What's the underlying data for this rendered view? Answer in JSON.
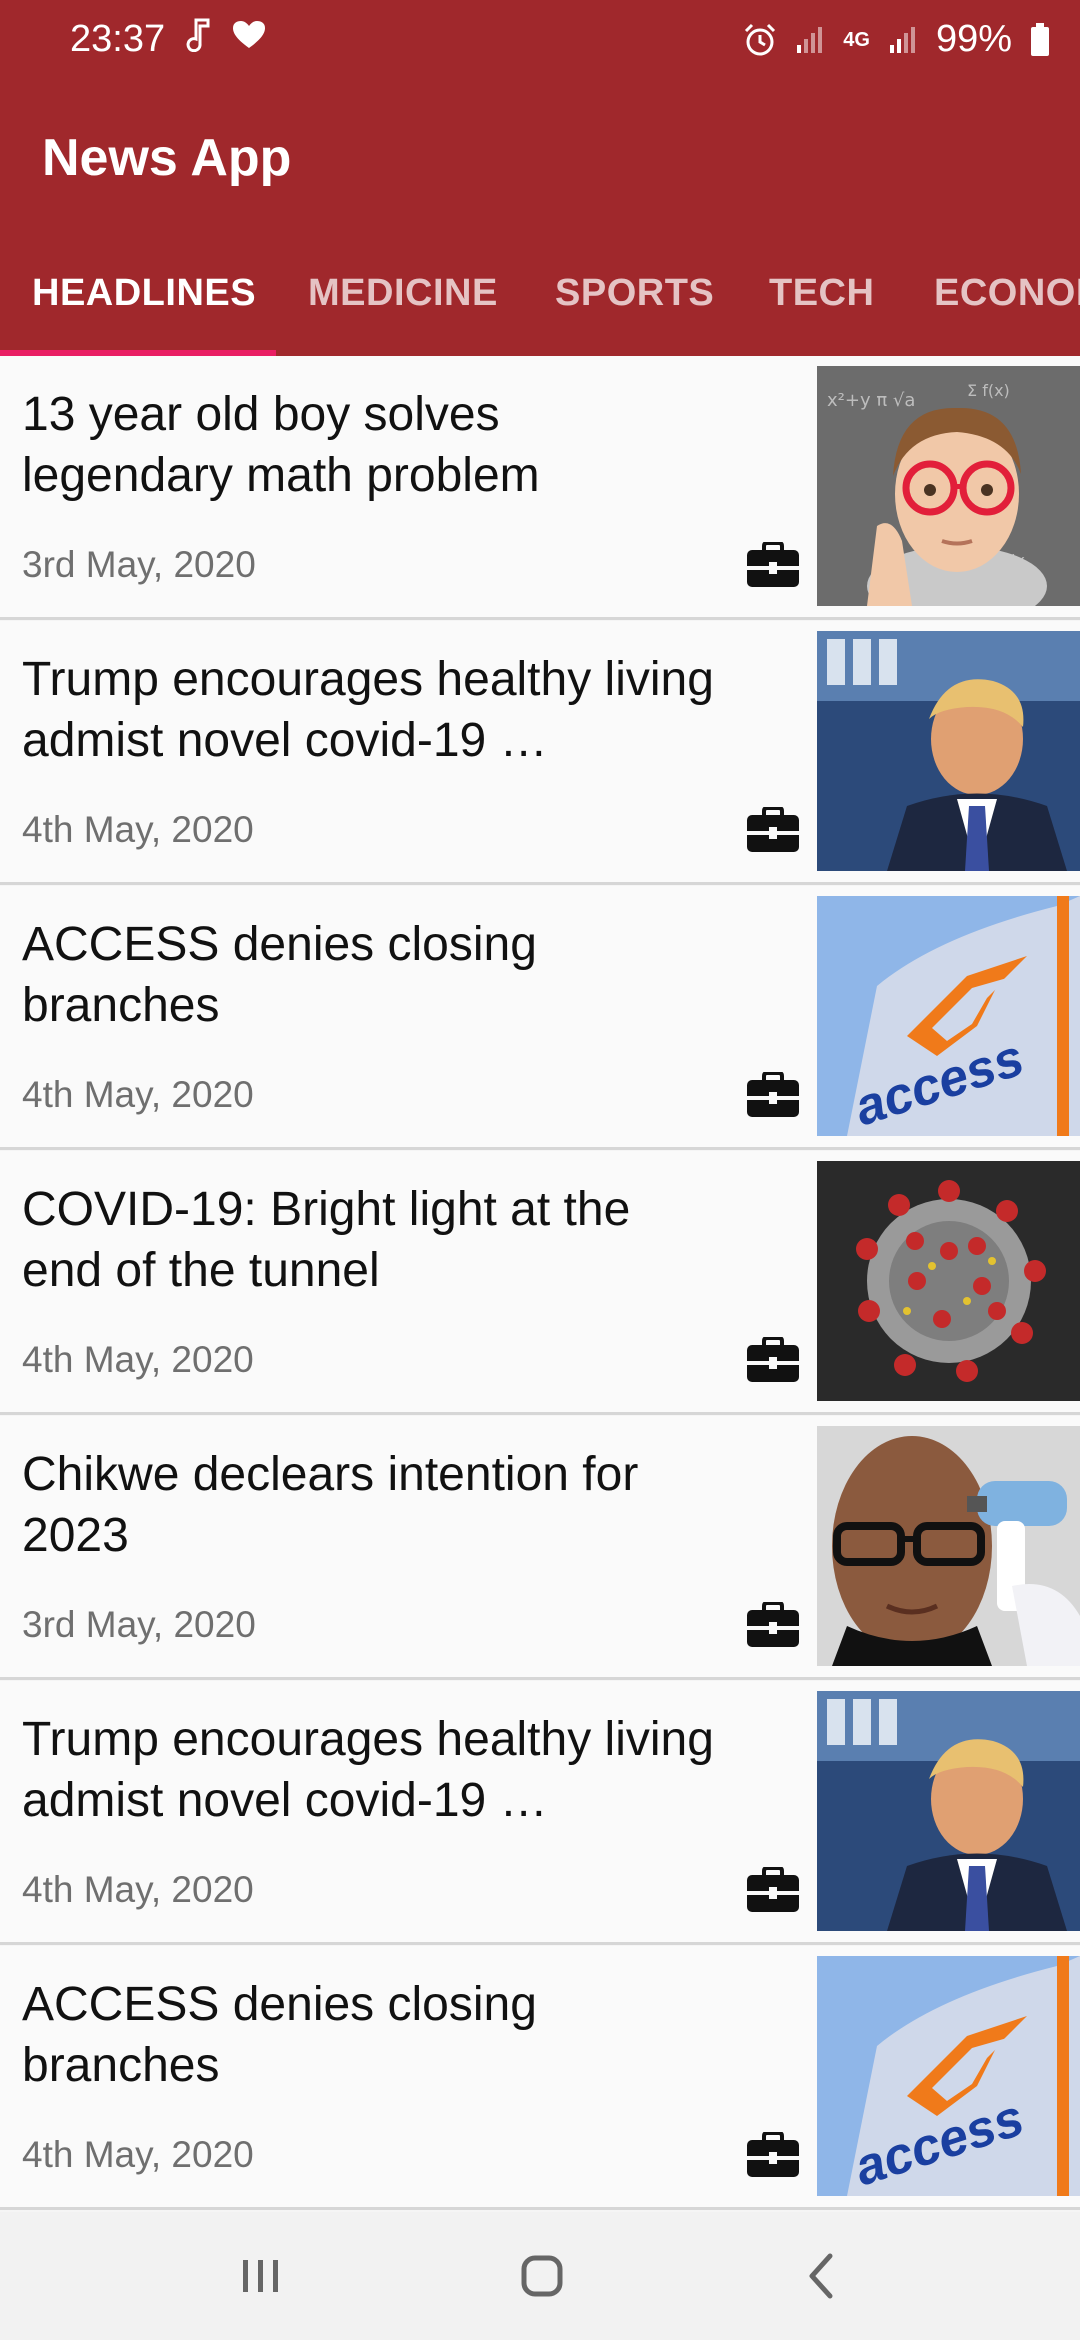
{
  "status_bar": {
    "time": "23:37",
    "left_icons": [
      "music-note-icon",
      "heart-icon"
    ],
    "right_icons": [
      "alarm-icon",
      "signal-icon",
      "network-4g-icon",
      "signal-icon",
      "battery-icon"
    ],
    "network_label": "4G",
    "battery": "99%"
  },
  "app_bar": {
    "title": "News App"
  },
  "tabs": [
    {
      "label": "HEADLINES",
      "active": true
    },
    {
      "label": "MEDICINE",
      "active": false
    },
    {
      "label": "SPORTS",
      "active": false
    },
    {
      "label": "TECH",
      "active": false
    },
    {
      "label": "ECONOMY",
      "active": false
    }
  ],
  "articles": [
    {
      "title": "13 year old boy solves legendary math problem",
      "date": "3rd May, 2020",
      "image": "boy-glasses-chalkboard"
    },
    {
      "title": "Trump encourages healthy living admist novel covid-19 …",
      "date": "4th May, 2020",
      "image": "white-house-podium"
    },
    {
      "title": "ACCESS denies closing branches",
      "date": "4th May, 2020",
      "image": "access-bank-sign"
    },
    {
      "title": "COVID-19: Bright light at the end of the tunnel",
      "date": "4th May, 2020",
      "image": "coronavirus-particle"
    },
    {
      "title": "Chikwe declears intention for 2023",
      "date": "3rd May, 2020",
      "image": "thermometer-screening"
    },
    {
      "title": "Trump encourages healthy living admist novel covid-19 …",
      "date": "4th May, 2020",
      "image": "white-house-podium"
    },
    {
      "title": "ACCESS denies closing branches",
      "date": "4th May, 2020",
      "image": "access-bank-sign"
    }
  ],
  "article_icon": "briefcase-icon",
  "nav_bar": [
    "recent-apps-icon",
    "home-icon",
    "back-icon"
  ],
  "colors": {
    "brand": "#a0282c",
    "indicator": "#e91e63",
    "date_text": "#6f6f6f"
  }
}
